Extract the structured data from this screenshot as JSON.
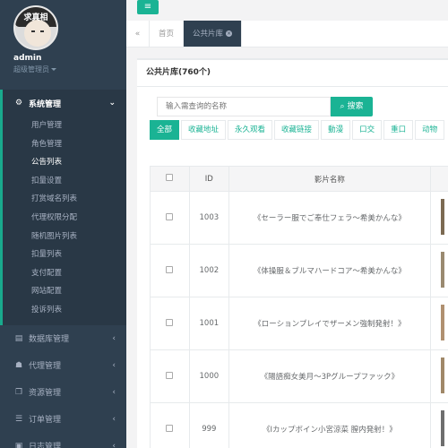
{
  "profile": {
    "avatar_text": "求真相",
    "name": "admin",
    "role": "超级管理员"
  },
  "sidebar": {
    "open_section": {
      "label": "系统管理"
    },
    "sub_items": [
      {
        "label": "用户管理",
        "active": false
      },
      {
        "label": "角色管理",
        "active": false
      },
      {
        "label": "公告列表",
        "active": true
      },
      {
        "label": "扣量设置",
        "active": false
      },
      {
        "label": "打赏域名列表",
        "active": false
      },
      {
        "label": "代理权限分配",
        "active": false
      },
      {
        "label": "随机图片列表",
        "active": false
      },
      {
        "label": "扣量列表",
        "active": false
      },
      {
        "label": "支付配置",
        "active": false
      },
      {
        "label": "网站配置",
        "active": false
      },
      {
        "label": "投诉列表",
        "active": false
      }
    ],
    "sections": [
      {
        "label": "数据库管理",
        "icon": "database-icon"
      },
      {
        "label": "代理管理",
        "icon": "users-icon"
      },
      {
        "label": "资源管理",
        "icon": "copy-icon"
      },
      {
        "label": "订单管理",
        "icon": "list-icon"
      },
      {
        "label": "日志管理",
        "icon": "log-icon"
      }
    ]
  },
  "tabs": [
    {
      "label": "首页",
      "active": false
    },
    {
      "label": "公共片库",
      "active": true
    }
  ],
  "panel": {
    "title": "公共片库(760个)",
    "search_placeholder": "输入需查询的名称",
    "search_button": "搜索"
  },
  "filters": [
    "全部",
    "收藏地址",
    "永久观看",
    "收藏链接",
    "動漫",
    "口交",
    "重口",
    "动物"
  ],
  "table": {
    "headers": [
      "",
      "ID",
      "影片名称",
      ""
    ],
    "rows": [
      {
        "id": "1003",
        "name": "《セーラー服でご奉仕フェラ～希美かんな》"
      },
      {
        "id": "1002",
        "name": "《体操服＆ブルマハードコア～希美かんな》"
      },
      {
        "id": "1001",
        "name": "《ローションプレイでザーメン強制発射！》"
      },
      {
        "id": "1000",
        "name": "《陽語痴女美月～3Pグループファック》"
      },
      {
        "id": "999",
        "name": "《Iカップボイン小宮涼菜 膣内発射！》"
      }
    ]
  },
  "colors": {
    "sidebar_bg": "#2f4050",
    "accent": "#1ab394"
  }
}
